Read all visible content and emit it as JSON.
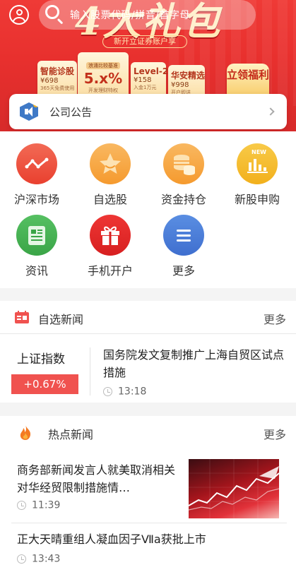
{
  "banner": {
    "title": "4大礼包",
    "subtitle": "新开立证券账户享",
    "cards": [
      {
        "title": "智能诊股",
        "price": "¥698",
        "note": "365天免费使用"
      },
      {
        "title": "浪涌比较基准",
        "value": "5.x%",
        "note": "开发理财特权"
      },
      {
        "title": "Level-2",
        "price": "¥158",
        "note": "入金1万元"
      },
      {
        "title": "华安精选",
        "price": "¥998",
        "note": "开户即送"
      }
    ],
    "claim_label": "立领福利"
  },
  "search": {
    "placeholder": "输入股票代码/拼音/首字母"
  },
  "notice": {
    "label": "公司公告"
  },
  "grid": [
    {
      "label": "沪深市场",
      "icon": "market-trend-icon",
      "color": "#ef5340"
    },
    {
      "label": "自选股",
      "icon": "star-icon",
      "color": "#f7a53b"
    },
    {
      "label": "资金持仓",
      "icon": "coins-icon",
      "color": "#f7a53b"
    },
    {
      "label": "新股申购",
      "icon": "new-stock-icon",
      "color": "#f5bd23",
      "badge": "NEW"
    },
    {
      "label": "资讯",
      "icon": "news-icon",
      "color": "#45b252"
    },
    {
      "label": "手机开户",
      "icon": "gift-icon",
      "color": "#e8292a"
    },
    {
      "label": "更多",
      "icon": "menu-icon",
      "color": "#4a7fd8"
    }
  ],
  "watch_news": {
    "title": "自选新闻",
    "more": "更多",
    "index_name": "上证指数",
    "index_change": "+0.67%",
    "headline": "国务院发文复制推广上海自贸区试点措施",
    "time": "13:18"
  },
  "hot_news": {
    "title": "热点新闻",
    "more": "更多",
    "items": [
      {
        "headline": "商务部新闻发言人就美取消相关对华经贸限制措施情…",
        "time": "11:39"
      },
      {
        "headline": "正大天晴重组人凝血因子Ⅶa获批上市",
        "time": "13:43"
      }
    ]
  },
  "colors": {
    "accent_red": "#e8302e",
    "up_red": "#f0524f"
  }
}
